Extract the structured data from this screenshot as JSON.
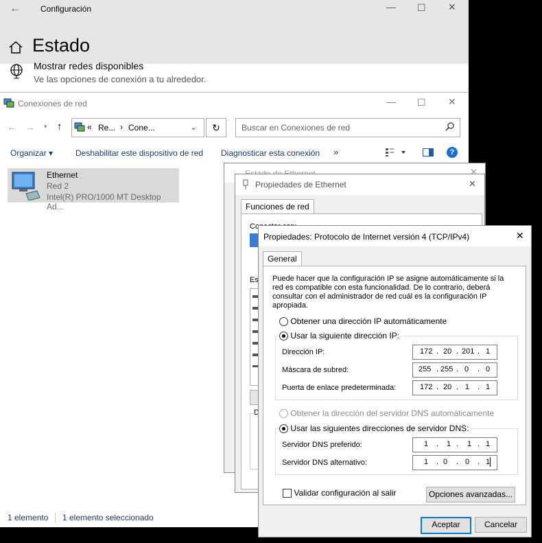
{
  "settings": {
    "title": "Configuración",
    "heading": "Estado",
    "item_title": "Mostrar redes disponibles",
    "item_subtitle": "Ve las opciones de conexión a tu alrededor."
  },
  "netconn": {
    "title": "Conexiones de red",
    "address_parts": [
      "Re...",
      "Cone..."
    ],
    "search_placeholder": "Buscar en Conexiones de red",
    "commands": [
      "Organizar",
      "Deshabilitar este dispositivo de red",
      "Diagnosticar esta conexión",
      "»"
    ],
    "adapter": {
      "name": "Ethernet",
      "network": "Red 2",
      "device": "Intel(R) PRO/1000 MT Desktop Ad..."
    },
    "status_count": "1 elemento",
    "status_selected": "1 elemento seleccionado"
  },
  "estado_dialog": {
    "title": "Estado de Ethernet"
  },
  "props_dialog": {
    "title": "Propiedades de Ethernet",
    "tab": "Funciones de red",
    "partial_labels": [
      "Conectar con:",
      "Es",
      "D"
    ]
  },
  "ipv4_dialog": {
    "title": "Propiedades: Protocolo de Internet versión 4 (TCP/IPv4)",
    "tab": "General",
    "description": "Puede hacer que la configuración IP se asigne automáticamente si la red es compatible con esta funcionalidad. De lo contrario, deberá consultar con el administrador de red cuál es la configuración IP apropiada.",
    "radio_auto_ip": "Obtener una dirección IP automáticamente",
    "radio_manual_ip": "Usar la siguiente dirección IP:",
    "ip_label": "Dirección IP:",
    "ip": [
      "172",
      "20",
      "201",
      "1"
    ],
    "mask_label": "Máscara de subred:",
    "mask": [
      "255",
      "255",
      "0",
      "0"
    ],
    "gateway_label": "Puerta de enlace predeterminada:",
    "gateway": [
      "172",
      "20",
      "1",
      "1"
    ],
    "radio_auto_dns": "Obtener la dirección del servidor DNS automáticamente",
    "radio_manual_dns": "Usar las siguientes direcciones de servidor DNS:",
    "dns1_label": "Servidor DNS preferido:",
    "dns1": [
      "1",
      "1",
      "1",
      "1"
    ],
    "dns2_label": "Servidor DNS alternativo:",
    "dns2": [
      "1",
      "0",
      "0",
      "1"
    ],
    "validate_label": "Validar configuración al salir",
    "advanced_button": "Opciones avanzadas...",
    "ok_button": "Aceptar",
    "cancel_button": "Cancelar"
  }
}
